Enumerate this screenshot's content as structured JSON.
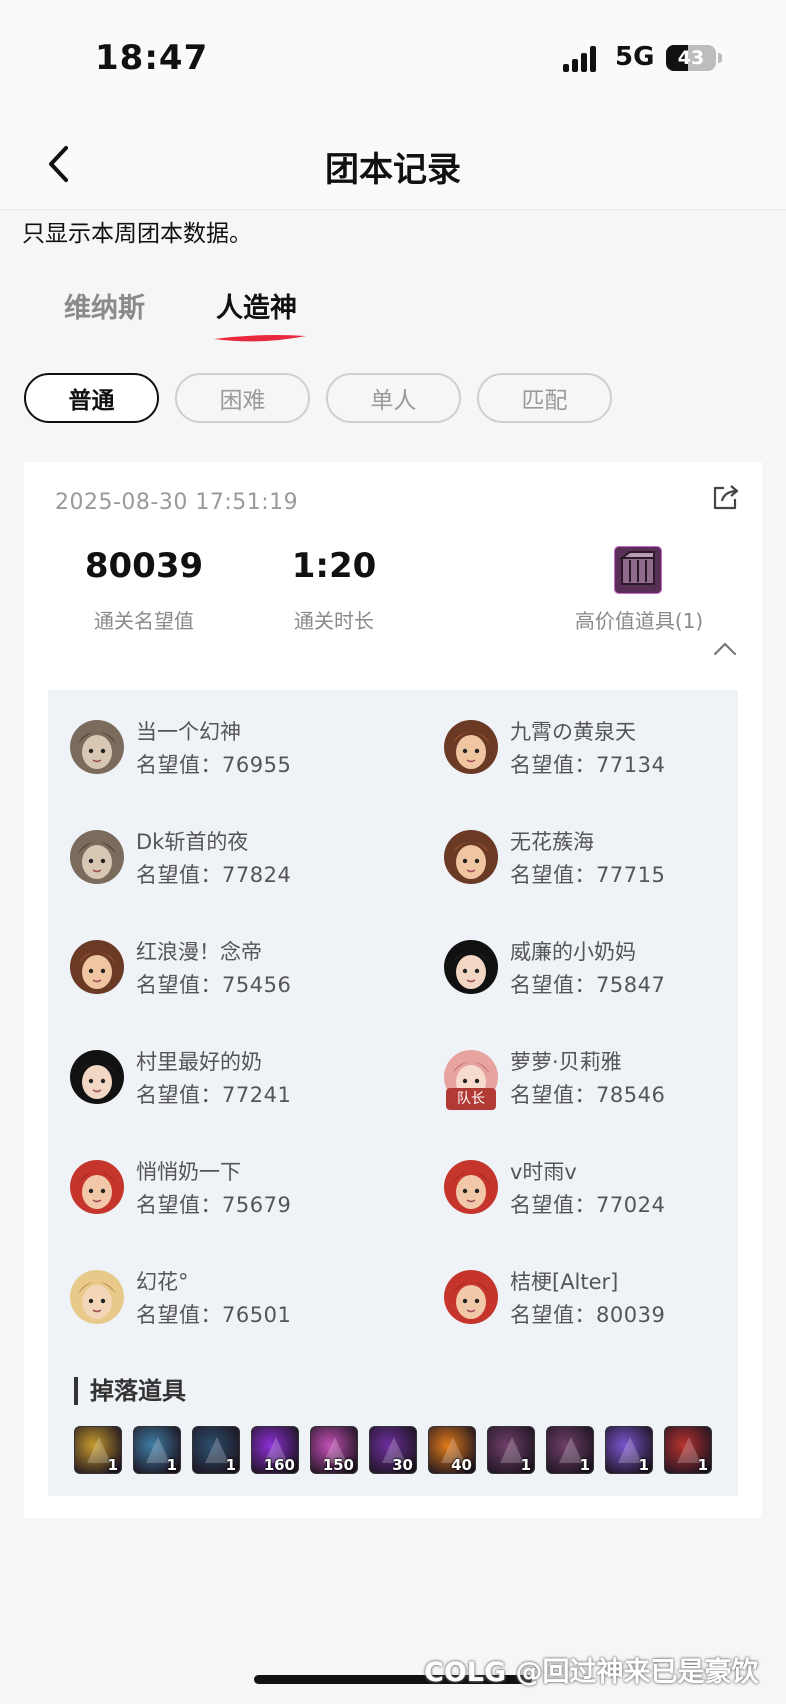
{
  "status_bar": {
    "time": "18:47",
    "network": "5G",
    "battery": "43"
  },
  "header": {
    "title": "团本记录"
  },
  "notice": "只显示本周团本数据。",
  "tabs": [
    {
      "label": "维纳斯",
      "active": false
    },
    {
      "label": "人造神",
      "active": true
    }
  ],
  "filters": [
    {
      "label": "普通",
      "active": true
    },
    {
      "label": "困难",
      "active": false
    },
    {
      "label": "单人",
      "active": false
    },
    {
      "label": "匹配",
      "active": false
    }
  ],
  "record": {
    "date": "2025-08-30 17:51:19",
    "fame_value": "80039",
    "fame_label": "通关名望值",
    "duration_value": "1:20",
    "duration_label": "通关时长",
    "high_value_label": "高价值道具(1)"
  },
  "members": [
    {
      "name": "当一个幻神",
      "fame": "名望值：76955",
      "avatar": "armored-male-avatar"
    },
    {
      "name": "九霄の黄泉天",
      "fame": "名望值：77134",
      "avatar": "female-fighter-avatar"
    },
    {
      "name": "Dk斩首的夜",
      "fame": "名望值：77824",
      "avatar": "armored-male-avatar"
    },
    {
      "name": "无花蔟海",
      "fame": "名望值：77715",
      "avatar": "female-fighter-avatar"
    },
    {
      "name": "红浪漫！念帝",
      "fame": "名望值：75456",
      "avatar": "female-fighter-avatar"
    },
    {
      "name": "威廉的小奶妈",
      "fame": "名望值：75847",
      "avatar": "dark-hair-priest-avatar"
    },
    {
      "name": "村里最好的奶",
      "fame": "名望值：77241",
      "avatar": "dark-hair-priest-avatar"
    },
    {
      "name": "萝萝·贝莉雅",
      "fame": "名望值：78546",
      "avatar": "pink-hair-avatar",
      "badge": "队长"
    },
    {
      "name": "悄悄奶一下",
      "fame": "名望值：75679",
      "avatar": "red-hair-mage-avatar"
    },
    {
      "name": "v时雨v",
      "fame": "名望值：77024",
      "avatar": "red-hair-mage-avatar"
    },
    {
      "name": "幻花°",
      "fame": "名望值：76501",
      "avatar": "blonde-gunner-avatar"
    },
    {
      "name": "桔梗[Alter]",
      "fame": "名望值：80039",
      "avatar": "red-hair-mage-avatar"
    }
  ],
  "drops": {
    "title": "掉落道具",
    "items": [
      {
        "icon": "weapon-gun-icon",
        "count": "1",
        "color": "#c79a2c"
      },
      {
        "icon": "crystal-armor-icon",
        "count": "1",
        "color": "#3f7ea6"
      },
      {
        "icon": "dark-blade-icon",
        "count": "1",
        "color": "#2c4f6e"
      },
      {
        "icon": "purple-orb-icon",
        "count": "160",
        "color": "#8d2fd6"
      },
      {
        "icon": "purple-star-icon",
        "count": "150",
        "color": "#c34fb5"
      },
      {
        "icon": "purple-gem-icon",
        "count": "30",
        "color": "#6d2f9e"
      },
      {
        "icon": "flame-orb-icon",
        "count": "40",
        "color": "#e07a1a"
      },
      {
        "icon": "crate-icon",
        "count": "1",
        "color": "#6f3f6a"
      },
      {
        "icon": "crate-icon",
        "count": "1",
        "color": "#6f3f6a"
      },
      {
        "icon": "potion-icon",
        "count": "1",
        "color": "#7a55d0"
      },
      {
        "icon": "red-potion-icon",
        "count": "1",
        "color": "#b83230"
      }
    ]
  },
  "watermark": "COLG @回过神来已是豪饮"
}
